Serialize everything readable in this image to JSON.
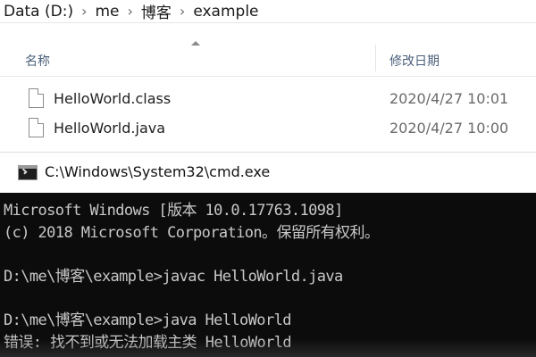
{
  "explorer": {
    "breadcrumb": [
      "Data (D:)",
      "me",
      "博客",
      "example"
    ],
    "separator": "›",
    "columns": {
      "name": "名称",
      "date_modified": "修改日期"
    },
    "files": [
      {
        "name": "HelloWorld.class",
        "modified": "2020/4/27 10:01",
        "icon": "file-icon"
      },
      {
        "name": "HelloWorld.java",
        "modified": "2020/4/27 10:00",
        "icon": "file-icon"
      }
    ]
  },
  "cmd": {
    "title": "C:\\Windows\\System32\\cmd.exe",
    "icon": "cmd-icon",
    "lines": [
      "Microsoft Windows [版本 10.0.17763.1098]",
      "(c) 2018 Microsoft Corporation。保留所有权利。",
      "D:\\me\\博客\\example>javac HelloWorld.java",
      "D:\\me\\博客\\example>java HelloWorld",
      "错误: 找不到或无法加载主类 HelloWorld"
    ],
    "background": "#0c0c0c",
    "foreground": "#c8c8c8"
  }
}
